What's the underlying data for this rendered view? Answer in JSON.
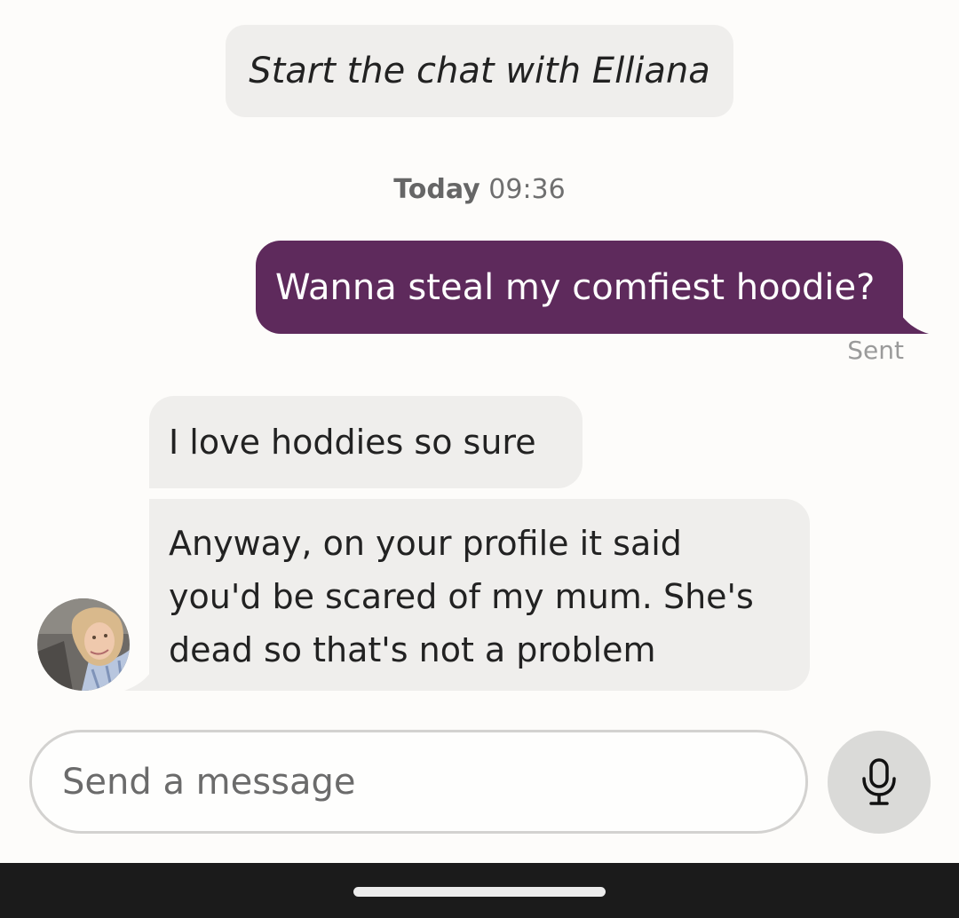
{
  "chat": {
    "start_prompt": "Start the chat with Elliana",
    "timestamp_day": "Today",
    "timestamp_time": "09:36",
    "sent_status": "Sent",
    "colors": {
      "outgoing_bubble": "#5e2a5c",
      "incoming_bubble": "#efeeec",
      "background": "#fdfcfa"
    }
  },
  "messages": {
    "outgoing_1": "Wanna steal my comfiest hoodie?",
    "incoming_1": "I love hoddies so sure",
    "incoming_2_lines": [
      "Anyway, on your profile it said",
      "you'd be scared of my mum. She's",
      "dead so that's not a problem"
    ]
  },
  "composer": {
    "placeholder": "Send a message",
    "mic_icon": "microphone-icon"
  }
}
